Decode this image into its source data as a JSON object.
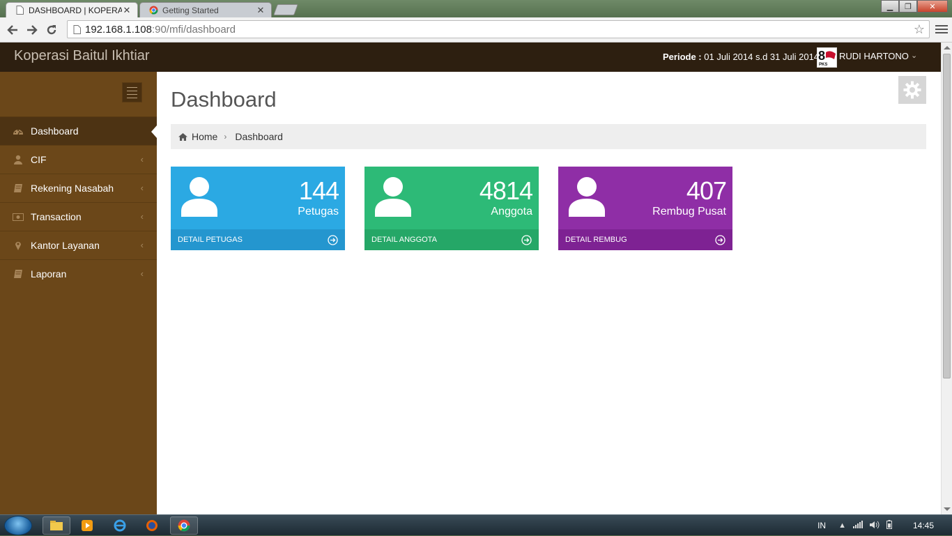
{
  "browser": {
    "tabs": [
      {
        "title": "DASHBOARD | KOPERASI I",
        "active": true
      },
      {
        "title": "Getting Started",
        "active": false
      }
    ],
    "url_host": "192.168.1.108",
    "url_rest": ":90/mfi/dashboard"
  },
  "app": {
    "brand": "Koperasi Baitul Ikhtiar",
    "periode_label": "Periode : ",
    "periode_value": "01 Juli 2014 s.d 31 Juli 2014",
    "user_name": "RUDI HARTONO",
    "avatar_caption": "PKS"
  },
  "sidebar": {
    "items": [
      {
        "label": "Dashboard",
        "icon": "dashboard-icon",
        "active": true
      },
      {
        "label": "CIF",
        "icon": "user-icon"
      },
      {
        "label": "Rekening Nasabah",
        "icon": "book-icon"
      },
      {
        "label": "Transaction",
        "icon": "money-icon"
      },
      {
        "label": "Kantor Layanan",
        "icon": "map-marker-icon"
      },
      {
        "label": "Laporan",
        "icon": "book-icon"
      }
    ]
  },
  "page": {
    "title": "Dashboard",
    "breadcrumb": [
      "Home",
      "Dashboard"
    ]
  },
  "stats": [
    {
      "value": "144",
      "label": "Petugas",
      "link": "DETAIL PETUGAS",
      "color": "#2ba9e3"
    },
    {
      "value": "4814",
      "label": "Anggota",
      "link": "DETAIL ANGGOTA",
      "color": "#2dba77"
    },
    {
      "value": "407",
      "label": "Rembug Pusat",
      "link": "DETAIL REMBUG",
      "color": "#8f2ea6"
    }
  ],
  "taskbar": {
    "lang": "IN",
    "clock": "14:45"
  }
}
